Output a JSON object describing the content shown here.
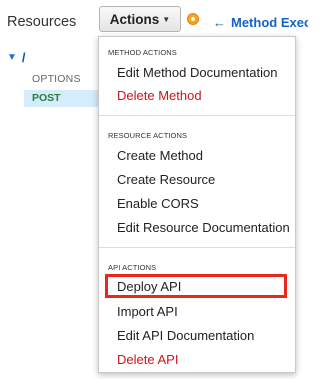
{
  "left_panel": {
    "title": "Resources",
    "root_path": "/",
    "methods": [
      "OPTIONS",
      "POST"
    ]
  },
  "header": {
    "actions_label": "Actions",
    "method_execution_label": "Method Exec",
    "back_arrow": "←"
  },
  "menu": {
    "sections": [
      {
        "title": "METHOD ACTIONS",
        "items": [
          "Edit Method Documentation",
          "Delete Method"
        ]
      },
      {
        "title": "RESOURCE ACTIONS",
        "items": [
          "Create Method",
          "Create Resource",
          "Enable CORS",
          "Edit Resource Documentation"
        ]
      },
      {
        "title": "API ACTIONS",
        "items": [
          "Deploy API",
          "Import API",
          "Edit API Documentation",
          "Delete API"
        ]
      }
    ]
  },
  "colors": {
    "danger": "#d0131b",
    "highlight_border": "#e8281e",
    "link": "#1463c7",
    "selected_bg": "#d4ecfb",
    "status_dot": "#f6a623"
  },
  "icons": {
    "tree_caret": "caret-down-icon",
    "actions_caret": "chevron-down-icon",
    "status": "status-dot-icon",
    "back": "arrow-left-icon"
  }
}
